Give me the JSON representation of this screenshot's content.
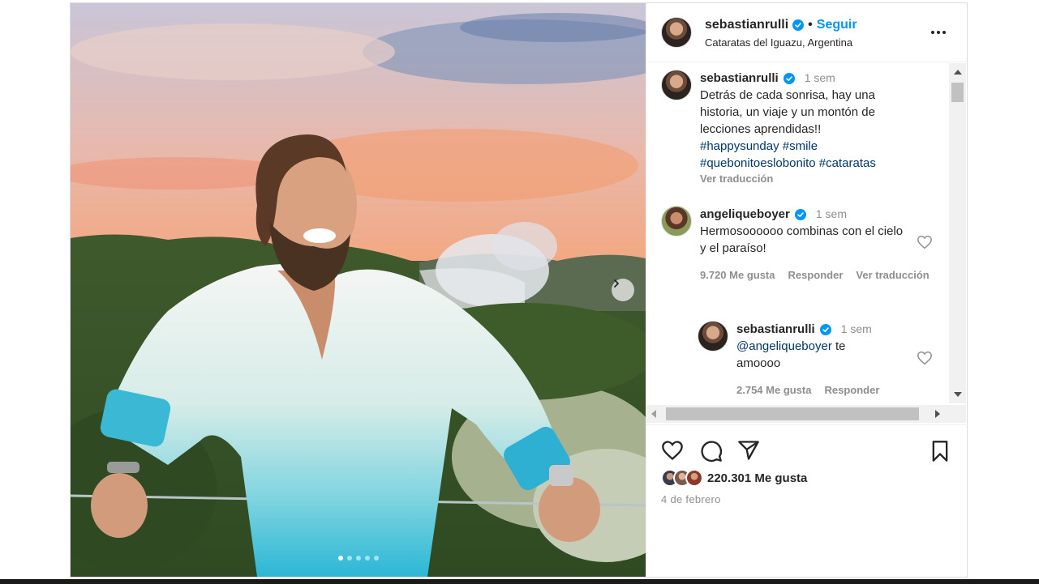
{
  "post": {
    "author": "sebastianrulli",
    "follow_label": "Seguir",
    "bullet": "•",
    "location": "Cataratas del Iguazu, Argentina",
    "more_icon": "more-horizontal-icon",
    "carousel": {
      "slides": 5,
      "active_slide": 1
    }
  },
  "caption": {
    "author": "sebastianrulli",
    "time": "1 sem",
    "text": "Detrás de cada sonrisa, hay una historia, un viaje y un montón de lecciones aprendidas!!",
    "hashtags_line1": "#happysunday #smile",
    "hashtags_line2": "#quebonitoeslobonito #cataratas",
    "translate": "Ver traducción"
  },
  "comments": [
    {
      "author": "angeliqueboyer",
      "time": "1 sem",
      "text": "Hermosoooooo combinas con el cielo y el paraíso!",
      "likes": "9.720 Me gusta",
      "reply": "Responder",
      "translate": "Ver traducción"
    },
    {
      "author": "sebastianrulli",
      "time": "1 sem",
      "mention": "@angeliqueboyer",
      "text": " te amoooo",
      "likes": "2.754 Me gusta",
      "reply": "Responder"
    }
  ],
  "footer": {
    "likes_count": "220.301 Me gusta",
    "date": "4 de febrero"
  },
  "colors": {
    "accent": "#0095f6",
    "verified": "#0095f6",
    "muted": "#8e8e8e",
    "link": "#00376b"
  }
}
